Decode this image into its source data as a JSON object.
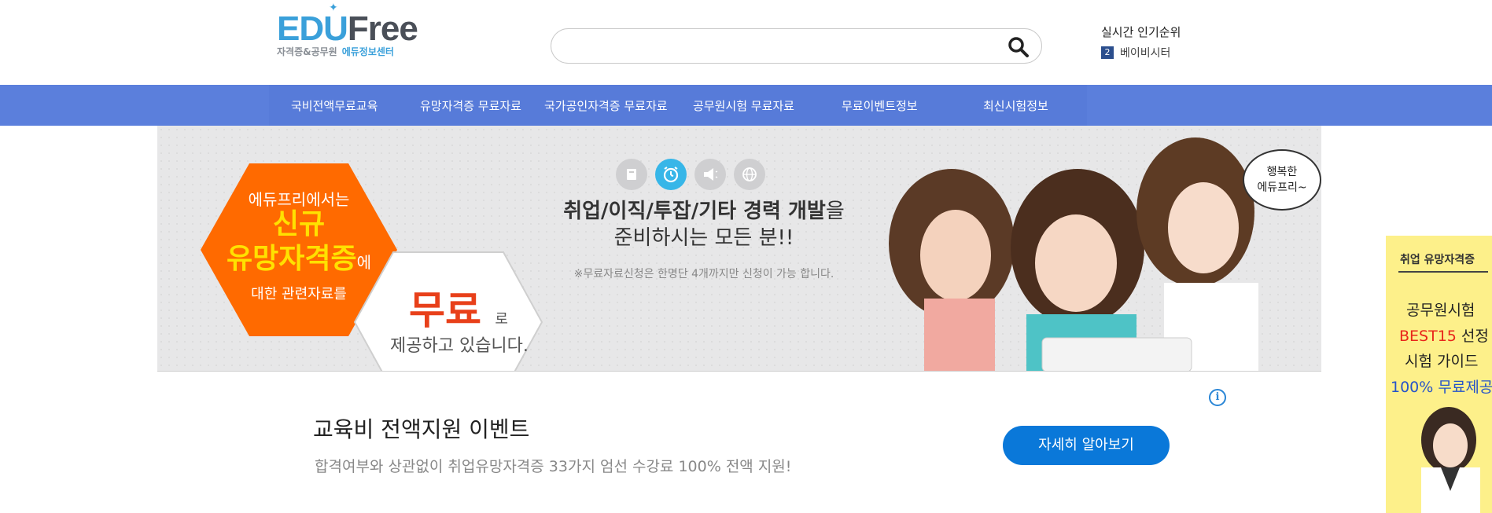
{
  "header": {
    "logo": {
      "edu": "EDU",
      "free": "Free",
      "sub1": "자격증&공무원",
      "sub2": "에듀정보센터"
    },
    "search": {
      "placeholder": "",
      "value": ""
    },
    "ranking": {
      "title": "실시간 인기순위",
      "items": [
        {
          "rank": "2",
          "label": "베이비시터"
        }
      ]
    }
  },
  "nav": {
    "items": [
      {
        "label": "국비전액무료교육"
      },
      {
        "label": "유망자격증 무료자료"
      },
      {
        "label": "국가공인자격증 무료자료"
      },
      {
        "label": "공무원시험 무료자료"
      },
      {
        "label": "무료이벤트정보"
      },
      {
        "label": "최신시험정보"
      }
    ]
  },
  "banner": {
    "hex_line1": "에듀프리에서는",
    "hex_line2": "신규",
    "hex_line3": "유망자격증",
    "hex_line3_suffix": "에",
    "hex_line4": "대한 관련자료를",
    "free_big": "무료",
    "free_suffix": "로",
    "free_line2": "제공하고 있습니다.",
    "headline_bold": "취업/이직/투잡/기타 경력 개발",
    "headline_suffix": "을",
    "headline_line2": "준비하시는 모든 분!!",
    "notice": "※무료자료신청은 한명단 4개까지만 신청이 가능 합니다.",
    "bubble_line1": "행복한",
    "bubble_line2": "에듀프리~",
    "icons": [
      "book-icon",
      "alarm-clock-icon",
      "megaphone-icon",
      "globe-icon"
    ]
  },
  "event": {
    "title": "교육비 전액지원 이벤트",
    "description": "합격여부와 상관없이 취업유망자격증 33가지 엄선 수강료 100% 전액 지원!",
    "button": "자세히 알아보기",
    "info": "i"
  },
  "side_ad": {
    "title": "취업 유망자격증",
    "line1": "공무원시험",
    "line2_red": "BEST15",
    "line2_rest": " 선정",
    "line3": "시험 가이드",
    "line4": "100% 무료제공"
  },
  "colors": {
    "nav_bg": "#5b7fdc",
    "accent_blue": "#0a78d9",
    "logo_blue": "#3aa0da",
    "orange": "#ff6a00",
    "yellow": "#ffe100",
    "side_ad_bg": "#fdf08a"
  }
}
